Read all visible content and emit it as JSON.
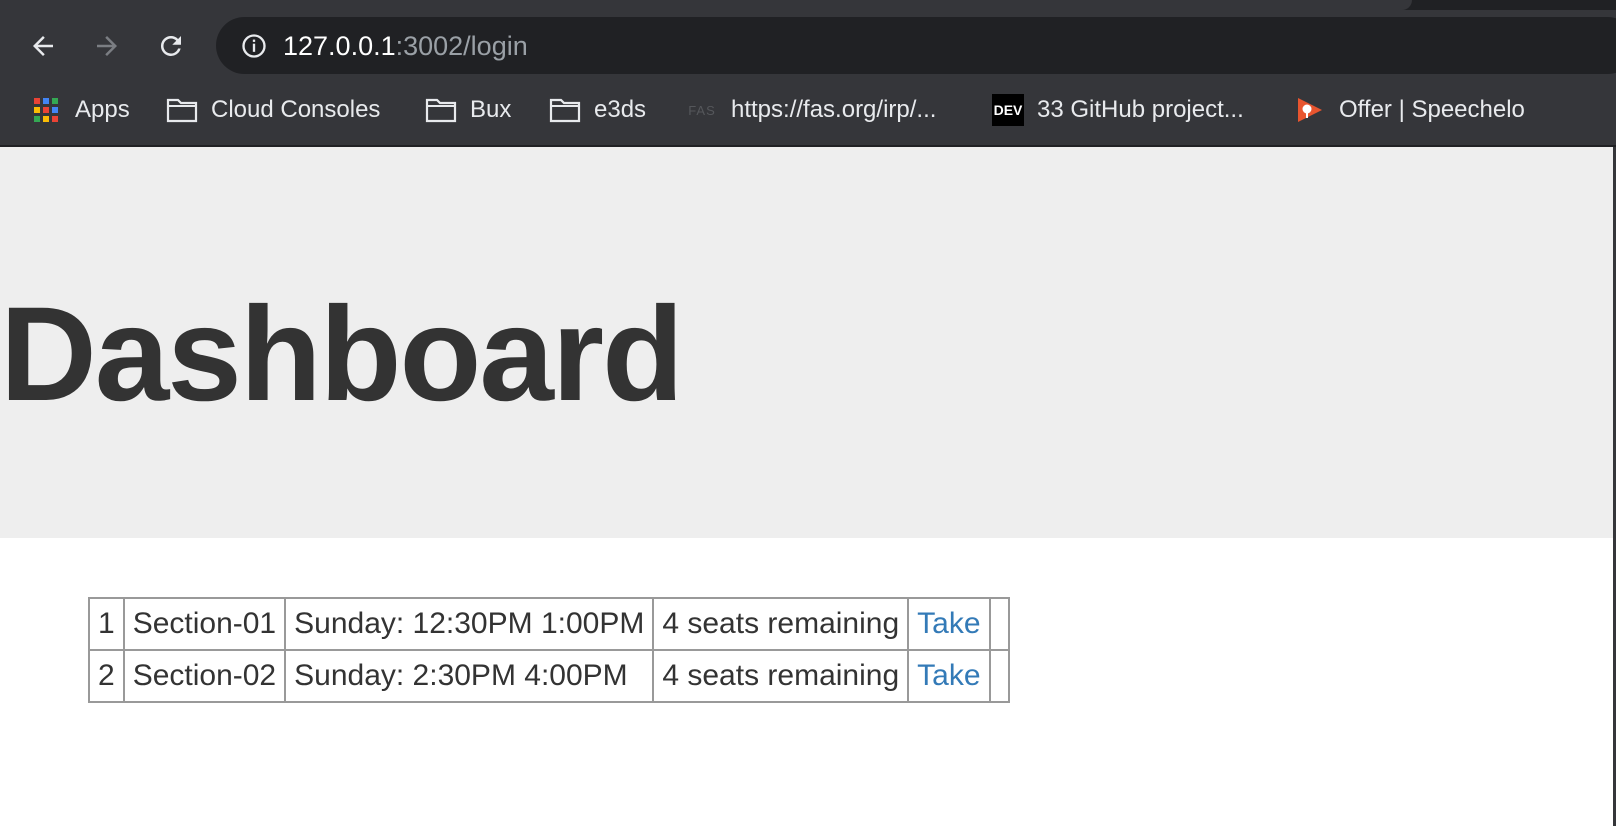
{
  "browser": {
    "url_host": "127.0.0.1",
    "url_path": ":3002/login",
    "bookmarks": [
      {
        "label": "Apps",
        "icon": "apps-grid-icon"
      },
      {
        "label": "Cloud Consoles",
        "icon": "folder-icon"
      },
      {
        "label": "Bux",
        "icon": "folder-icon"
      },
      {
        "label": "e3ds",
        "icon": "folder-icon"
      },
      {
        "label": "https://fas.org/irp/...",
        "icon": "fas-icon",
        "icon_text": "FAS"
      },
      {
        "label": "33 GitHub project...",
        "icon": "dev-icon",
        "icon_text": "DEV"
      },
      {
        "label": "Offer | Speechelo",
        "icon": "speechelo-icon"
      }
    ]
  },
  "page": {
    "title": "Dashboard"
  },
  "sections_table": {
    "rows": [
      {
        "num": "1",
        "section": "Section-01",
        "schedule": "Sunday: 12:30PM 1:00PM",
        "seats": "4 seats remaining",
        "action": "Take"
      },
      {
        "num": "2",
        "section": "Section-02",
        "schedule": "Sunday: 2:30PM 4:00PM",
        "seats": "4 seats remaining",
        "action": "Take"
      }
    ]
  },
  "colors": {
    "chrome_bg": "#35363a",
    "omnibox_bg": "#202124",
    "jumbotron_bg": "#eeeeee",
    "link": "#337ab7",
    "text": "#333333"
  }
}
